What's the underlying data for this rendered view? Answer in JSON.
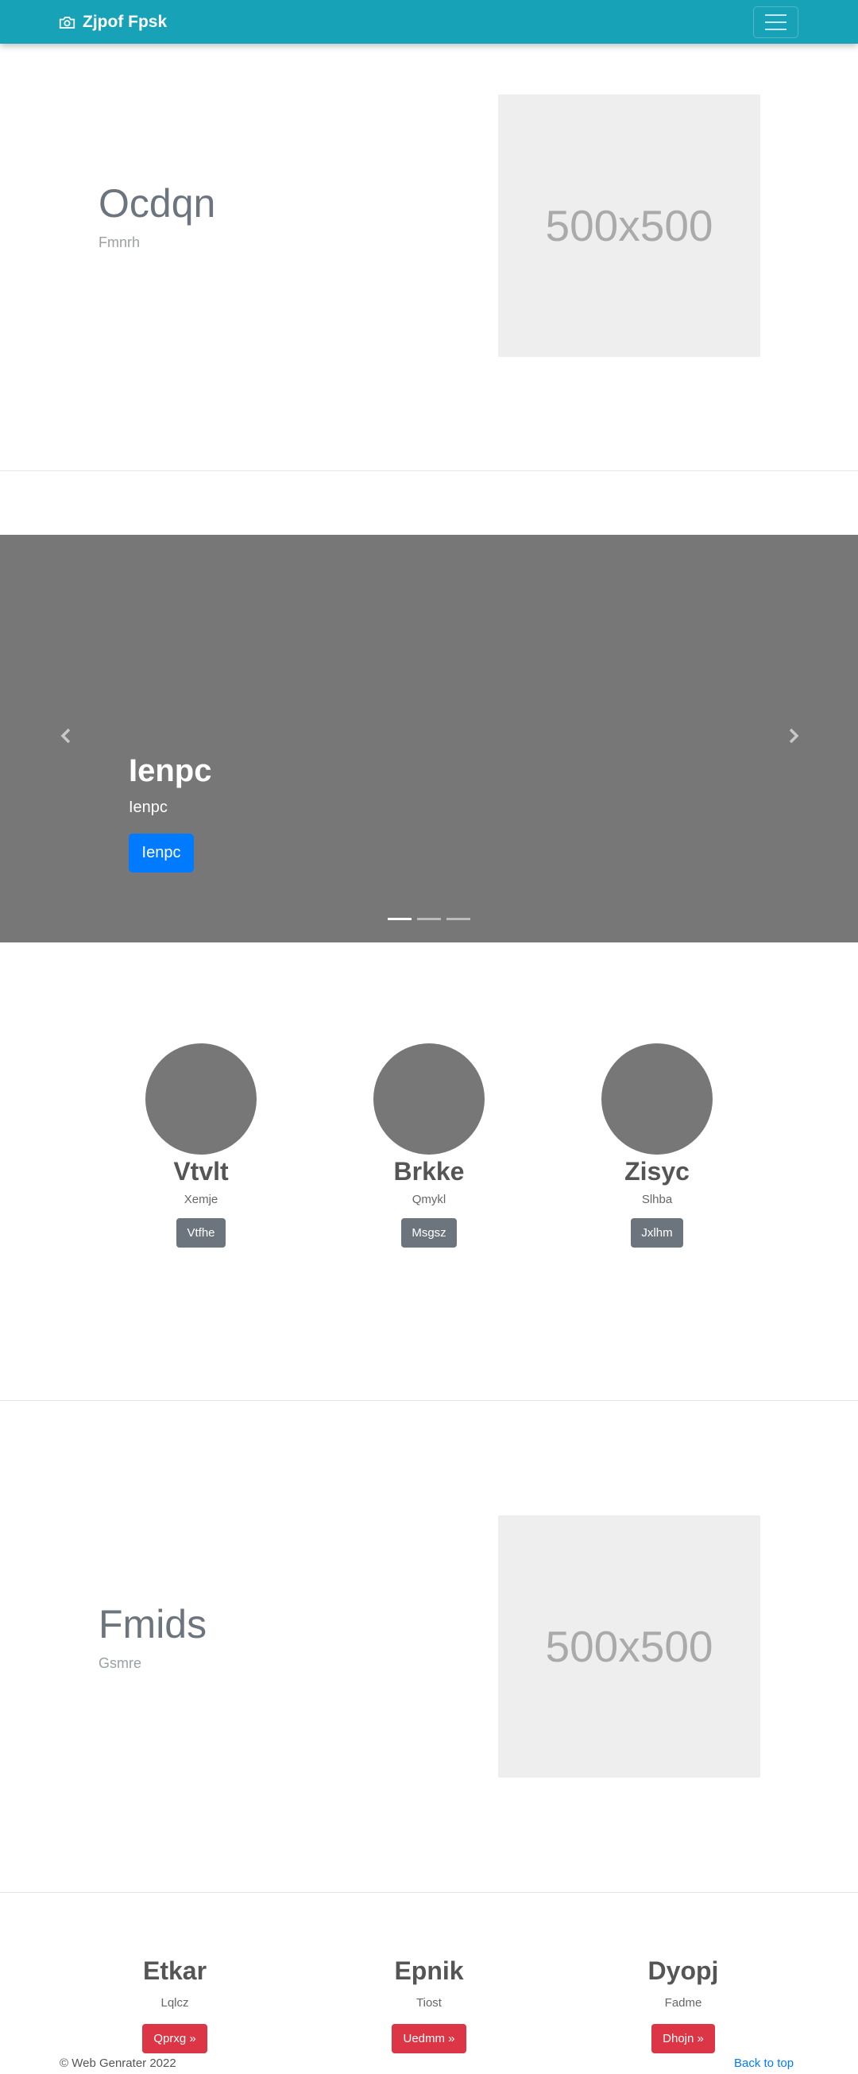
{
  "navbar": {
    "brand": "Zjpof Fpsk",
    "brand_icon": "camera-icon",
    "toggler_icon": "hamburger-menu-icon",
    "background": "#17a2b8"
  },
  "featurette1": {
    "heading": "Ocdqn",
    "subheading": "Fmnrh",
    "image_label": "500x500"
  },
  "carousel": {
    "title": "Ienpc",
    "text": "Ienpc",
    "button": "Ienpc",
    "prev_icon": "chevron-left-icon",
    "next_icon": "chevron-right-icon",
    "slide_count": 3,
    "active_slide": 1
  },
  "marketing": [
    {
      "name": "Vtvlt",
      "sub": "Xemje",
      "button": "Vtfhe"
    },
    {
      "name": "Brkke",
      "sub": "Qmykl",
      "button": "Msgsz"
    },
    {
      "name": "Zisyc",
      "sub": "Slhba",
      "button": "Jxlhm"
    }
  ],
  "featurette2": {
    "heading": "Fmids",
    "subheading": "Gsmre",
    "image_label": "500x500"
  },
  "bottom": [
    {
      "name": "Etkar",
      "sub": "Lqlcz",
      "button": "Qprxg »"
    },
    {
      "name": "Epnik",
      "sub": "Tiost",
      "button": "Uedmm »"
    },
    {
      "name": "Dyopj",
      "sub": "Fadme",
      "button": "Dhojn »"
    }
  ],
  "footer": {
    "copyright": "© Web Genrater 2022",
    "back_to_top": "Back to top"
  },
  "colors": {
    "primary": "#007bff",
    "secondary": "#6c757d",
    "danger": "#dc3545",
    "carousel_bg": "#777777",
    "placeholder_bg": "#eeeeee"
  }
}
